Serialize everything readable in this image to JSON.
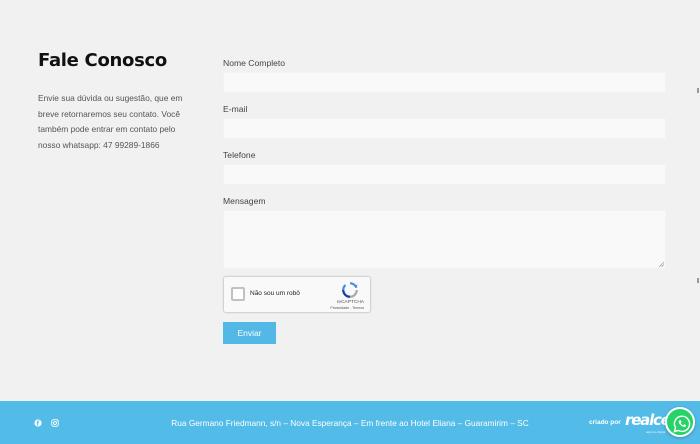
{
  "contact": {
    "title": "Fale Conosco",
    "description": "Envie sua dúvida ou sugestão, que em breve retornaremos seu contato. Você também pode entrar em contato pelo nosso whatsapp: 47 99289-1866"
  },
  "form": {
    "name_label": "Nome Completo",
    "name_value": "",
    "email_label": "E-mail",
    "email_value": "",
    "phone_label": "Telefone",
    "phone_value": "",
    "message_label": "Mensagem",
    "message_value": "",
    "submit_label": "Enviar"
  },
  "captcha": {
    "checkbox_label": "Não sou um robô",
    "brand": "reCAPTCHA",
    "links": "Privacidade - Termos"
  },
  "footer": {
    "address": "Rua Germano Friedmann, s/n – Nova Esperança – Em frente ao Hotel Eliana – Guaramirim – SC",
    "credit_label": "criado por",
    "brand": "realce",
    "brand_sub": "agência digital"
  },
  "icons": {
    "facebook": "facebook-icon",
    "instagram": "instagram-icon",
    "whatsapp": "whatsapp-icon",
    "recaptcha": "recaptcha-icon"
  },
  "colors": {
    "accent": "#53b8e6",
    "footer_bg": "#53bbe7",
    "whatsapp": "#25d366"
  }
}
